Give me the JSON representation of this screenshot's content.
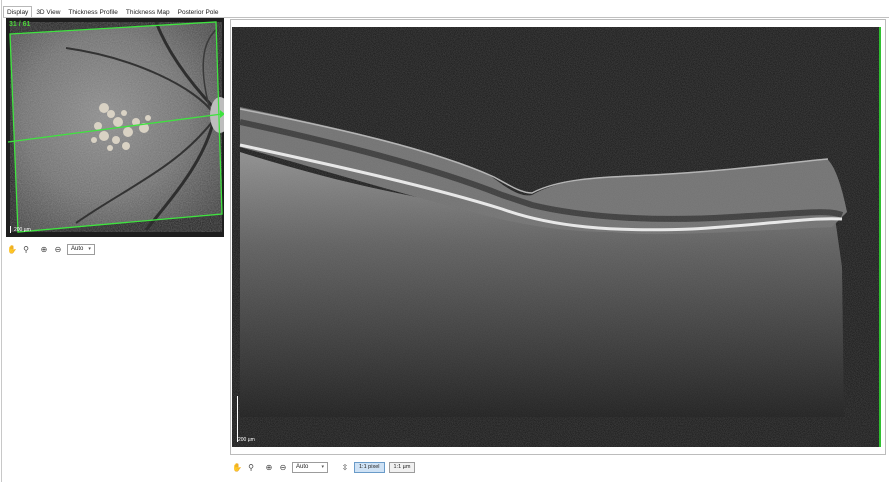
{
  "tabs": [
    {
      "label": "Display",
      "active": true
    },
    {
      "label": "3D View",
      "active": false
    },
    {
      "label": "Thickness Profile",
      "active": false
    },
    {
      "label": "Thickness Map",
      "active": false
    },
    {
      "label": "Posterior Pole",
      "active": false
    }
  ],
  "fundus": {
    "scan_counter": "31 / 61",
    "scale_label": "200 µm",
    "line_color": "#3fe33f"
  },
  "fundus_toolbar": {
    "icons": [
      "hand-pan-icon",
      "magnifier-icon",
      "zoom-in-icon",
      "zoom-out-icon"
    ],
    "zoom_value": "Auto"
  },
  "oct": {
    "scale_label": "200 µm",
    "marker_color": "#2fbf2f"
  },
  "oct_toolbar": {
    "icons": [
      "hand-pan-icon",
      "magnifier-icon",
      "zoom-in-icon",
      "zoom-out-icon",
      "fit-height-icon"
    ],
    "zoom_value": "Auto",
    "pixel_button": "1:1 pixel",
    "micron_button": "1:1 µm"
  }
}
